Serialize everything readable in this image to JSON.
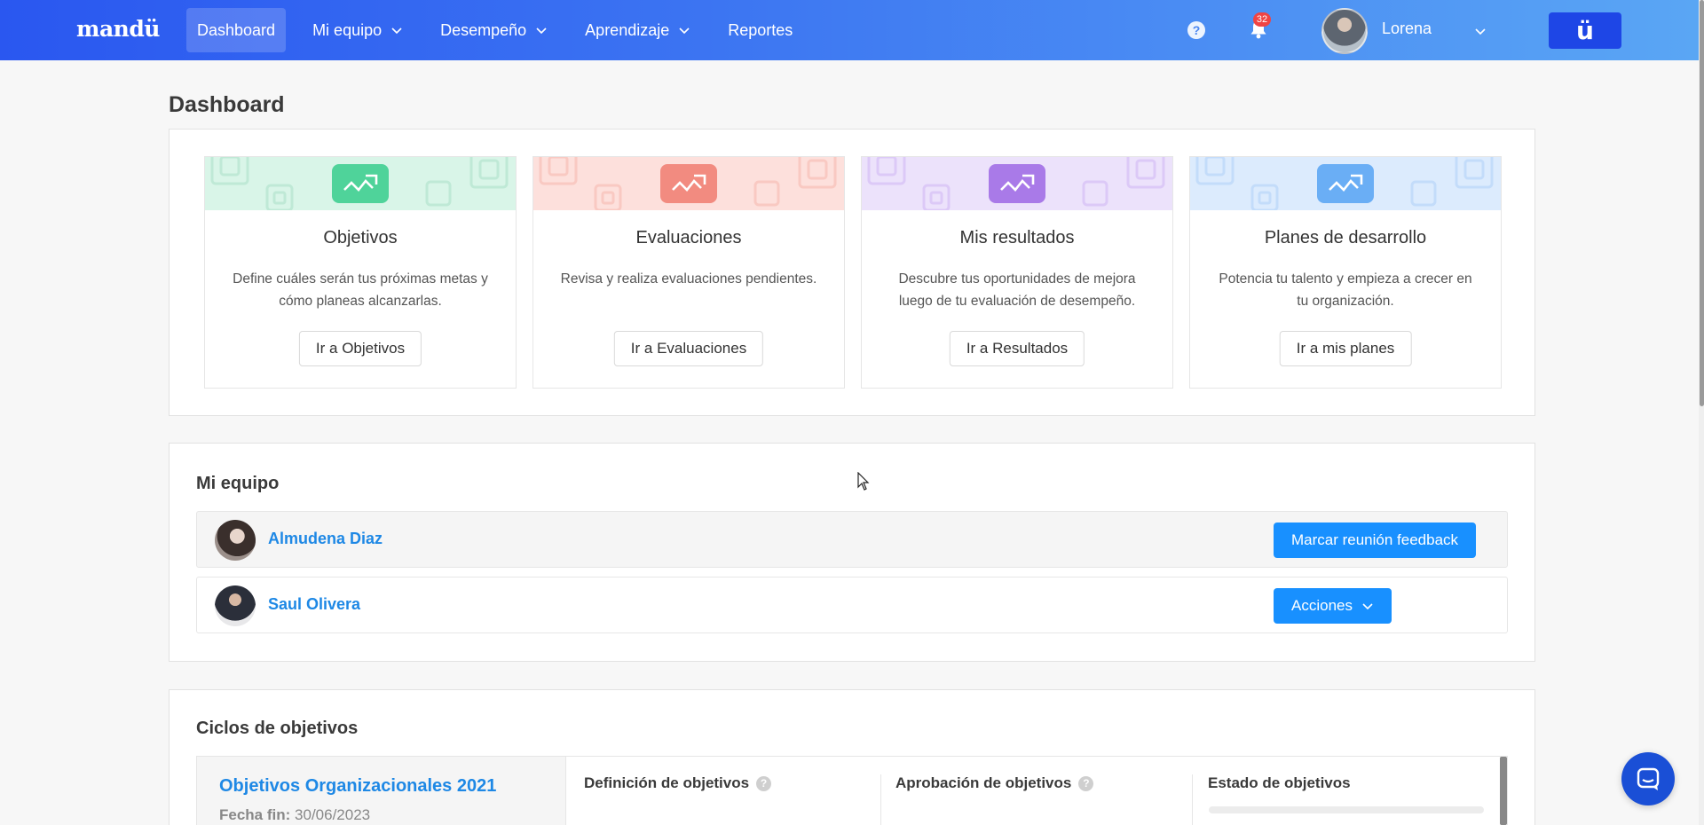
{
  "nav": {
    "logo": "mandü",
    "items": [
      {
        "label": "Dashboard",
        "active": true,
        "dropdown": false
      },
      {
        "label": "Mi equipo",
        "active": false,
        "dropdown": true
      },
      {
        "label": "Desempeño",
        "active": false,
        "dropdown": true
      },
      {
        "label": "Aprendizaje",
        "active": false,
        "dropdown": true
      },
      {
        "label": "Reportes",
        "active": false,
        "dropdown": false
      }
    ],
    "notification_count": "32",
    "user_name": "Lorena",
    "brand_button": "ü"
  },
  "page": {
    "title": "Dashboard"
  },
  "cards": [
    {
      "title": "Objetivos",
      "description": "Define cuáles serán tus próximas metas y cómo planeas alcanzarlas.",
      "button": "Ir a Objetivos",
      "color": "#7fe0b4",
      "banner": "#d9f5e8"
    },
    {
      "title": "Evaluaciones",
      "description": "Revisa y realiza evaluaciones pendientes.",
      "button": "Ir a Evaluaciones",
      "color": "#f49b92",
      "banner": "#fde0dc"
    },
    {
      "title": "Mis resultados",
      "description": "Descubre tus oportunidades de mejora luego de tu evaluación de desempeño.",
      "button": "Ir a Resultados",
      "color": "#b68cf0",
      "banner": "#ece2fb"
    },
    {
      "title": "Planes de desarrollo",
      "description": "Potencia tu talento y empieza a crecer en tu organización.",
      "button": "Ir a mis planes",
      "color": "#7fb7f5",
      "banner": "#dcebfd"
    }
  ],
  "team": {
    "title": "Mi equipo",
    "members": [
      {
        "name": "Almudena Diaz",
        "action": "Marcar reunión feedback"
      },
      {
        "name": "Saul Olivera",
        "action": "Acciones"
      }
    ]
  },
  "cycles": {
    "title": "Ciclos de objetivos",
    "items": [
      {
        "name": "Objetivos Organizacionales 2021",
        "date_label": "Fecha fin:",
        "date": "30/06/2023",
        "col1": "Definición de objetivos",
        "col2": "Aprobación de objetivos",
        "col3": "Estado de objetivos"
      }
    ]
  },
  "colors": {
    "accent": "#1890ff",
    "nav_start": "#2a57f0",
    "nav_end": "#5aa6f4",
    "link": "#1e88e5"
  }
}
